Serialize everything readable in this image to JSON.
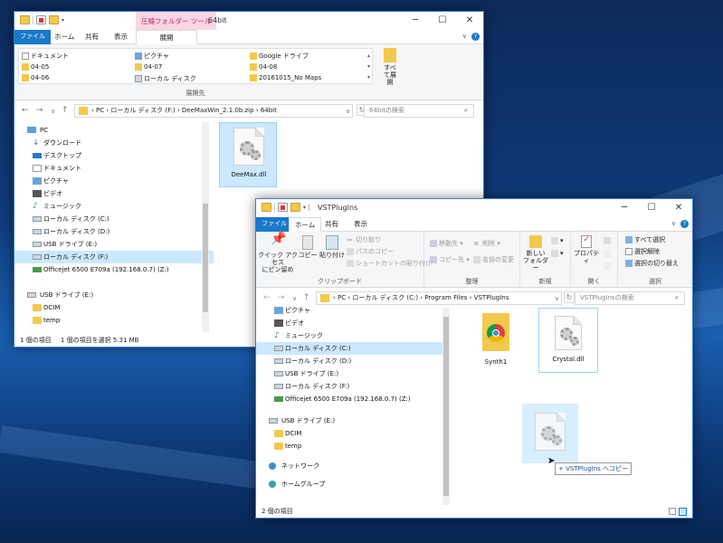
{
  "colors": {
    "accent": "#1979ca",
    "selection": "#cce8ff",
    "context_tab": "#b0286a"
  },
  "win1": {
    "title": "64bit",
    "context_tab": "圧縮フォルダー ツール",
    "tabs": [
      "ファイル",
      "ホーム",
      "共有",
      "表示",
      "展開"
    ],
    "dest_items": [
      "ドキュメント",
      "ピクチャ",
      "Google ドライブ",
      "04-05",
      "04-07",
      "04-08",
      "04-06",
      "ローカル ディスク",
      "20161015_No Maps"
    ],
    "dest_group_label": "展開先",
    "extract_all": "すべて展開",
    "address": [
      "PC",
      "ローカル ディスク (F:)",
      "DeeMaxWin_2.1.0b.zip",
      "64bit"
    ],
    "search_placeholder": "64bitの検索",
    "tree": [
      "PC",
      "ダウンロード",
      "デスクトップ",
      "ドキュメント",
      "ピクチャ",
      "ビデオ",
      "ミュージック",
      "ローカル ディスク (C:)",
      "ローカル ディスク (D:)",
      "USB ドライブ (E:)",
      "ローカル ディスク (F:)",
      "Officejet 6500 E709a (192.168.0.7) (Z:)",
      "USB ドライブ (E:)",
      "DCIM",
      "temp"
    ],
    "file": "DeeMax.dll",
    "status": [
      "1 個の項目",
      "1 個の項目を選択  5.31 MB"
    ]
  },
  "win2": {
    "title": "VSTPlugIns",
    "tabs": [
      "ファイル",
      "ホーム",
      "共有",
      "表示"
    ],
    "ribbon": {
      "quick_access": "クイック アクセス\nにピン留め",
      "copy": "コピー",
      "paste": "貼り付け",
      "cut": "切り取り",
      "copy_path": "パスのコピー",
      "paste_shortcut": "ショートカットの貼り付け",
      "clipboard": "クリップボード",
      "move_to": "移動先",
      "delete": "削除",
      "copy_to": "コピー先",
      "rename": "名前の変更",
      "organize": "整理",
      "new_folder": "新しい\nフォルダー",
      "new": "新規",
      "properties": "プロパティ",
      "open": "開く",
      "select_all": "すべて選択",
      "select_none": "選択解除",
      "invert": "選択の切り替え",
      "select": "選択"
    },
    "address": [
      "PC",
      "ローカル ディスク (C:)",
      "Program Files",
      "VSTPlugIns"
    ],
    "search_placeholder": "VSTPlugInsの検索",
    "tree": [
      "ピクチャ",
      "ビデオ",
      "ミュージック",
      "ローカル ディスク (C:)",
      "ローカル ディスク (D:)",
      "USB ドライブ (E:)",
      "ローカル ディスク (F:)",
      "Officejet 6500 E709a (192.168.0.7) (Z:)",
      "USB ドライブ (E:)",
      "DCIM",
      "temp",
      "ネットワーク",
      "ホームグループ"
    ],
    "files": [
      "Synth1",
      "Crystal.dll"
    ],
    "drag_tooltip": "+ VSTPlugIns へコピー",
    "status": "2 個の項目"
  }
}
